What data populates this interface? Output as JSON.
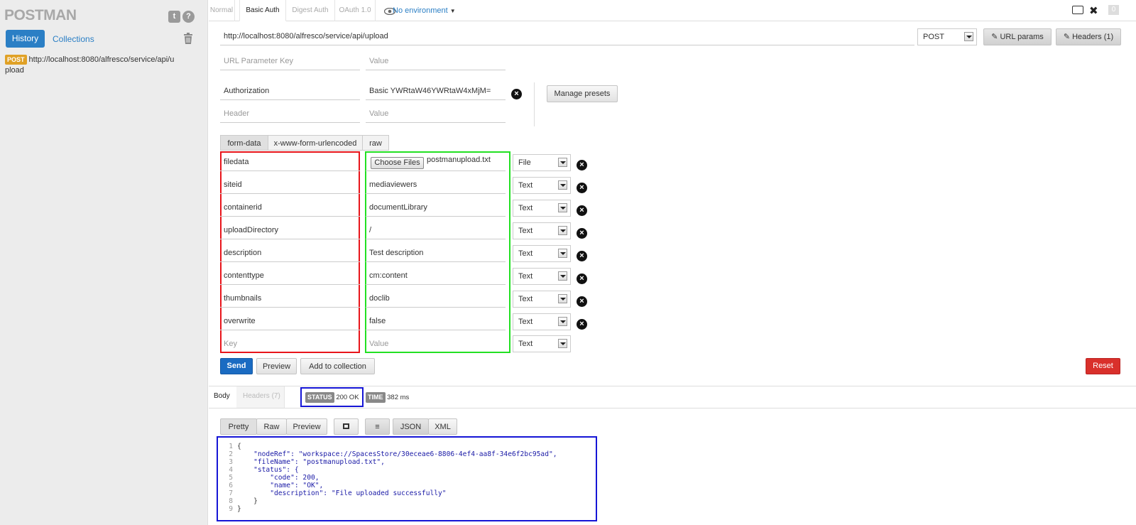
{
  "sidebar": {
    "logo": "POSTMAN",
    "tabs": {
      "history": "History",
      "collections": "Collections"
    },
    "history_items": [
      {
        "method": "POST",
        "url": "http://localhost:8080/alfresco/service/api/upload"
      }
    ]
  },
  "topbar": {
    "auth_tabs": [
      "Normal",
      "Basic Auth",
      "Digest Auth",
      "OAuth 1.0"
    ],
    "active_auth_tab": "Basic Auth",
    "environment": "No environment",
    "counter": "0"
  },
  "request": {
    "url": "http://localhost:8080/alfresco/service/api/upload",
    "method": "POST",
    "url_params_label": "URL params",
    "headers_label": "Headers (1)",
    "url_param_key_placeholder": "URL Parameter Key",
    "value_placeholder": "Value",
    "headers": [
      {
        "key": "Authorization",
        "value": "Basic YWRtaW46YWRtaW4xMjM="
      }
    ],
    "header_placeholder": "Header",
    "manage_presets_label": "Manage presets",
    "body_tabs": [
      "form-data",
      "x-www-form-urlencoded",
      "raw"
    ],
    "form_rows": [
      {
        "key": "filedata",
        "value": "postmanupload.txt",
        "type": "File",
        "choose_files": "Choose Files"
      },
      {
        "key": "siteid",
        "value": "mediaviewers",
        "type": "Text"
      },
      {
        "key": "containerid",
        "value": "documentLibrary",
        "type": "Text"
      },
      {
        "key": "uploadDirectory",
        "value": "/",
        "type": "Text"
      },
      {
        "key": "description",
        "value": "Test description",
        "type": "Text"
      },
      {
        "key": "contenttype",
        "value": "cm:content",
        "type": "Text"
      },
      {
        "key": "thumbnails",
        "value": "doclib",
        "type": "Text"
      },
      {
        "key": "overwrite",
        "value": "false",
        "type": "Text"
      }
    ],
    "new_row": {
      "key_placeholder": "Key",
      "value_placeholder": "Value",
      "type": "Text"
    },
    "actions": {
      "send": "Send",
      "preview": "Preview",
      "add_to_collection": "Add to collection",
      "reset": "Reset"
    }
  },
  "response": {
    "tabs": [
      "Body",
      "Headers (7)"
    ],
    "status_label": "STATUS",
    "status_value": "200 OK",
    "time_label": "TIME",
    "time_value": "382 ms",
    "view_tabs": [
      "Pretty",
      "Raw",
      "Preview"
    ],
    "format_tabs": [
      "JSON",
      "XML"
    ],
    "body_lines": [
      "{",
      "    \"nodeRef\": \"workspace://SpacesStore/30eceae6-8806-4ef4-aa8f-34e6f2bc95ad\",",
      "    \"fileName\": \"postmanupload.txt\",",
      "    \"status\": {",
      "        \"code\": 200,",
      "        \"name\": \"OK\",",
      "        \"description\": \"File uploaded successfully\"",
      "    }",
      "}"
    ]
  },
  "colors": {
    "accent_blue": "#2b7fc5",
    "send_blue": "#1a6bc2",
    "reset_red": "#d9302b",
    "key_box": "#e8151b",
    "value_box": "#22e022",
    "response_box": "#1515d6",
    "post_badge": "#e0a126"
  }
}
